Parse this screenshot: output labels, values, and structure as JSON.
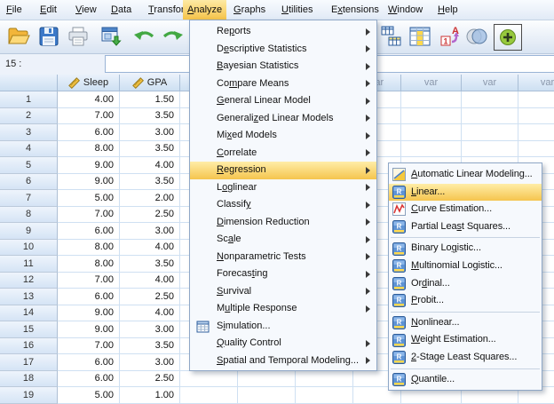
{
  "menubar": {
    "items": [
      {
        "label": "File",
        "u": 0
      },
      {
        "label": "Edit",
        "u": 0
      },
      {
        "label": "View",
        "u": 0
      },
      {
        "label": "Data",
        "u": 0
      },
      {
        "label": "Transform",
        "u": 0
      },
      {
        "label": "Analyze",
        "u": 0,
        "active": true
      },
      {
        "label": "Graphs",
        "u": 0
      },
      {
        "label": "Utilities",
        "u": 0
      },
      {
        "label": "Extensions",
        "u": 1
      },
      {
        "label": "Window",
        "u": 0
      },
      {
        "label": "Help",
        "u": 0
      }
    ]
  },
  "toolbar": {
    "left_icons": [
      "open-data-icon",
      "save-icon",
      "print-icon",
      "recall-dialogs-icon",
      "undo-icon",
      "redo-icon"
    ],
    "right_icons": [
      "split-file-icon",
      "insert-variable-icon",
      "value-labels-icon",
      "use-variable-sets-icon",
      "show-all-variables-icon"
    ],
    "value_labels_glyphs": {
      "one": "1",
      "a": "A"
    }
  },
  "cell_ref": {
    "label": "15 :",
    "value": ""
  },
  "grid": {
    "var_label": "var",
    "columns": [
      {
        "name": "Sleep",
        "icon": "scale-ruler-icon"
      },
      {
        "name": "GPA",
        "icon": "scale-ruler-icon"
      }
    ],
    "rows": [
      {
        "n": "1",
        "sleep": "4.00",
        "gpa": "1.50"
      },
      {
        "n": "2",
        "sleep": "7.00",
        "gpa": "3.50"
      },
      {
        "n": "3",
        "sleep": "6.00",
        "gpa": "3.00"
      },
      {
        "n": "4",
        "sleep": "8.00",
        "gpa": "3.50"
      },
      {
        "n": "5",
        "sleep": "9.00",
        "gpa": "4.00"
      },
      {
        "n": "6",
        "sleep": "9.00",
        "gpa": "3.50"
      },
      {
        "n": "7",
        "sleep": "5.00",
        "gpa": "2.00"
      },
      {
        "n": "8",
        "sleep": "7.00",
        "gpa": "2.50"
      },
      {
        "n": "9",
        "sleep": "6.00",
        "gpa": "3.00"
      },
      {
        "n": "10",
        "sleep": "8.00",
        "gpa": "4.00"
      },
      {
        "n": "11",
        "sleep": "8.00",
        "gpa": "3.50"
      },
      {
        "n": "12",
        "sleep": "7.00",
        "gpa": "4.00"
      },
      {
        "n": "13",
        "sleep": "6.00",
        "gpa": "2.50"
      },
      {
        "n": "14",
        "sleep": "9.00",
        "gpa": "4.00"
      },
      {
        "n": "15",
        "sleep": "9.00",
        "gpa": "3.00"
      },
      {
        "n": "16",
        "sleep": "7.00",
        "gpa": "3.50"
      },
      {
        "n": "17",
        "sleep": "6.00",
        "gpa": "3.00"
      },
      {
        "n": "18",
        "sleep": "6.00",
        "gpa": "2.50"
      },
      {
        "n": "19",
        "sleep": "5.00",
        "gpa": "1.00"
      }
    ]
  },
  "analyze_menu": {
    "items": [
      {
        "label": "Reports",
        "u": 2,
        "submenu": true
      },
      {
        "label": "Descriptive Statistics",
        "u": 1,
        "submenu": true
      },
      {
        "label": "Bayesian Statistics",
        "u": 0,
        "submenu": true
      },
      {
        "label": "Compare Means",
        "u": 2,
        "submenu": true
      },
      {
        "label": "General Linear Model",
        "u": 0,
        "submenu": true
      },
      {
        "label": "Generalized Linear Models",
        "u": 8,
        "submenu": true
      },
      {
        "label": "Mixed Models",
        "u": 2,
        "submenu": true
      },
      {
        "label": "Correlate",
        "u": 0,
        "submenu": true
      },
      {
        "label": "Regression",
        "u": 0,
        "submenu": true,
        "active": true
      },
      {
        "label": "Loglinear",
        "u": 1,
        "submenu": true
      },
      {
        "label": "Classify",
        "u": 7,
        "submenu": true
      },
      {
        "label": "Dimension Reduction",
        "u": 0,
        "submenu": true
      },
      {
        "label": "Scale",
        "u": 2,
        "submenu": true
      },
      {
        "label": "Nonparametric Tests",
        "u": 0,
        "submenu": true
      },
      {
        "label": "Forecasting",
        "u": 7,
        "submenu": true
      },
      {
        "label": "Survival",
        "u": 0,
        "submenu": true
      },
      {
        "label": "Multiple Response",
        "u": 1,
        "submenu": true
      },
      {
        "label": "Simulation...",
        "u": 1,
        "submenu": false,
        "icon": "simulation-icon"
      },
      {
        "label": "Quality Control",
        "u": 0,
        "submenu": true
      },
      {
        "label": "Spatial and Temporal Modeling...",
        "u": 0,
        "submenu": true
      }
    ]
  },
  "regression_submenu": {
    "items": [
      {
        "label": "Automatic Linear Modeling...",
        "u": 0,
        "icon": "automatic-linear-modeling-icon"
      },
      {
        "label": "Linear...",
        "u": 0,
        "icon": "linear-regression-icon",
        "active": true
      },
      {
        "label": "Curve Estimation...",
        "u": 0,
        "icon": "curve-estimation-icon"
      },
      {
        "label": "Partial Least Squares...",
        "u": 11,
        "icon": "partial-least-squares-icon"
      },
      {
        "separator": true
      },
      {
        "label": "Binary Logistic...",
        "u": 9,
        "icon": "binary-logistic-icon"
      },
      {
        "label": "Multinomial Logistic...",
        "u": 0,
        "icon": "multinomial-logistic-icon"
      },
      {
        "label": "Ordinal...",
        "u": 2,
        "icon": "ordinal-icon"
      },
      {
        "label": "Probit...",
        "u": 0,
        "icon": "probit-icon"
      },
      {
        "separator": true
      },
      {
        "label": "Nonlinear...",
        "u": 0,
        "icon": "nonlinear-icon"
      },
      {
        "label": "Weight Estimation...",
        "u": 0,
        "icon": "weight-estimation-icon"
      },
      {
        "label": "2-Stage Least Squares...",
        "u": 0,
        "icon": "two-stage-least-squares-icon"
      },
      {
        "separator": true
      },
      {
        "label": "Quantile...",
        "u": 0,
        "icon": "quantile-icon"
      }
    ]
  },
  "icons": {
    "r_glyph": "R"
  },
  "colors": {
    "menu_highlight_top": "#ffeda8",
    "menu_highlight_bottom": "#f5c54e",
    "panel_border": "#8fa7c6",
    "grid_line": "#cfe0f2",
    "var_text": "#8a97ab",
    "accent_blue": "#4377bb"
  }
}
